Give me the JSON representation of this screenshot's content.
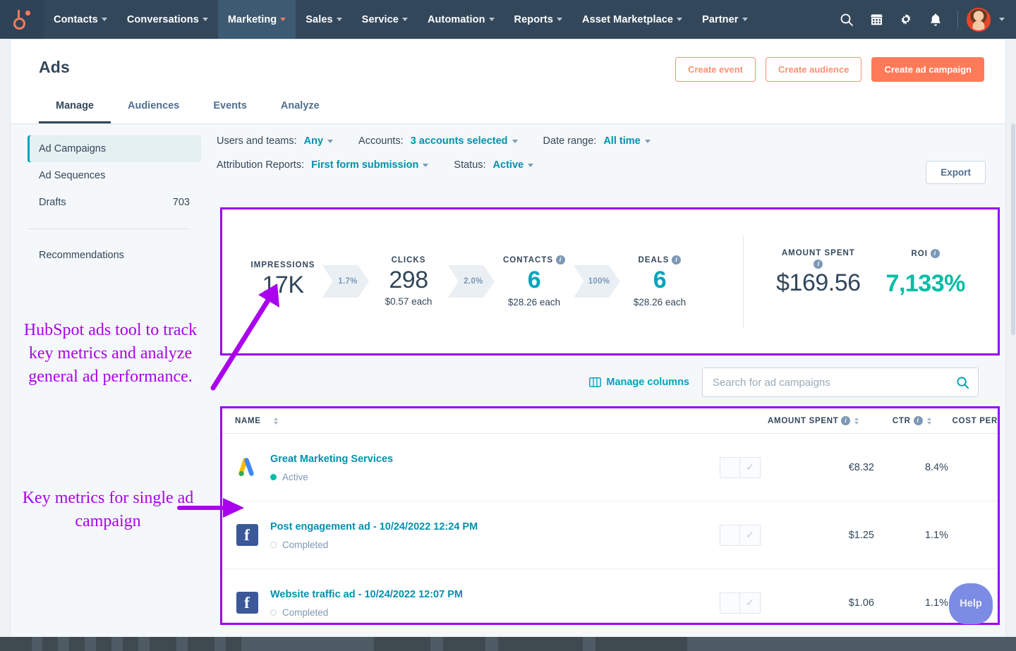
{
  "topnav": {
    "logo": "hubspot-logo",
    "items": [
      {
        "label": "Contacts",
        "active": false
      },
      {
        "label": "Conversations",
        "active": false
      },
      {
        "label": "Marketing",
        "active": true
      },
      {
        "label": "Sales",
        "active": false
      },
      {
        "label": "Service",
        "active": false
      },
      {
        "label": "Automation",
        "active": false
      },
      {
        "label": "Reports",
        "active": false
      },
      {
        "label": "Asset Marketplace",
        "active": false
      },
      {
        "label": "Partner",
        "active": false
      }
    ],
    "icons": [
      "search-icon",
      "marketplace-icon",
      "gear-icon",
      "notifications-icon"
    ]
  },
  "header": {
    "title": "Ads",
    "buttons": [
      {
        "label": "Create event",
        "style": "outline"
      },
      {
        "label": "Create audience",
        "style": "outline"
      },
      {
        "label": "Create ad campaign",
        "style": "primary"
      }
    ],
    "tabs": [
      {
        "label": "Manage",
        "active": true
      },
      {
        "label": "Audiences",
        "active": false
      },
      {
        "label": "Events",
        "active": false
      },
      {
        "label": "Analyze",
        "active": false
      }
    ]
  },
  "sidebar": {
    "items": [
      {
        "label": "Ad Campaigns",
        "count": "",
        "active": true
      },
      {
        "label": "Ad Sequences",
        "count": "",
        "active": false
      },
      {
        "label": "Drafts",
        "count": "703",
        "active": false
      }
    ],
    "secondary": [
      {
        "label": "Recommendations"
      }
    ]
  },
  "filters": {
    "row1": [
      {
        "label": "Users and teams:",
        "value": "Any"
      },
      {
        "label": "Accounts:",
        "value": "3 accounts selected"
      },
      {
        "label": "Date range:",
        "value": "All time"
      }
    ],
    "row2": [
      {
        "label": "Attribution Reports:",
        "value": "First form submission"
      },
      {
        "label": "Status:",
        "value": "Active"
      }
    ],
    "export_label": "Export"
  },
  "metrics": {
    "funnel": [
      {
        "label": "IMPRESSIONS",
        "value": "17K",
        "sub": "",
        "info": false,
        "accent": "dark"
      },
      {
        "label": "CLICKS",
        "value": "298",
        "sub": "$0.57 each",
        "info": false,
        "accent": "dark"
      },
      {
        "label": "CONTACTS",
        "value": "6",
        "sub": "$28.26 each",
        "info": true,
        "accent": "teal"
      },
      {
        "label": "DEALS",
        "value": "6",
        "sub": "$28.26 each",
        "info": true,
        "accent": "teal"
      }
    ],
    "conversions": [
      "1.7%",
      "2.0%",
      "100%"
    ],
    "amount_spent": {
      "label": "AMOUNT SPENT",
      "value": "$169.56",
      "info": true
    },
    "roi": {
      "label": "ROI",
      "value": "7,133%",
      "info": true
    }
  },
  "toolbar": {
    "manage_columns_label": "Manage columns",
    "search_placeholder": "Search for ad campaigns",
    "search_value": ""
  },
  "table": {
    "columns": [
      {
        "key": "name",
        "label": "NAME",
        "sortable": true,
        "info": false
      },
      {
        "key": "toggle",
        "label": "",
        "sortable": false,
        "info": false
      },
      {
        "key": "spent",
        "label": "AMOUNT SPENT",
        "sortable": true,
        "info": true
      },
      {
        "key": "ctr",
        "label": "CTR",
        "sortable": true,
        "info": true
      },
      {
        "key": "cost",
        "label": "COST PER",
        "sortable": false,
        "info": false
      }
    ],
    "rows": [
      {
        "network": "google-ads-icon",
        "name": "Great Marketing Services",
        "status": "Active",
        "status_type": "active",
        "spent": "€8.32",
        "ctr": "8.4%"
      },
      {
        "network": "facebook-icon",
        "name": "Post engagement ad - 10/24/2022 12:24 PM",
        "status": "Completed",
        "status_type": "completed",
        "spent": "$1.25",
        "ctr": "1.1%"
      },
      {
        "network": "facebook-icon",
        "name": "Website traffic ad - 10/24/2022 12:07 PM",
        "status": "Completed",
        "status_type": "completed",
        "spent": "$1.06",
        "ctr": "1.1%"
      }
    ]
  },
  "annotations": {
    "color": "#aa00ee",
    "note1": "HubSpot ads tool to track key metrics and analyze general ad performance.",
    "note2": "Key metrics for single ad campaign"
  },
  "help": {
    "label": "Help"
  },
  "colors": {
    "nav_bg": "#33475b",
    "accent_orange": "#ff7a59",
    "link_teal": "#0091ae",
    "value_teal": "#00a4bd",
    "roi_green": "#00bda5",
    "annotation_purple": "#9900f0"
  }
}
